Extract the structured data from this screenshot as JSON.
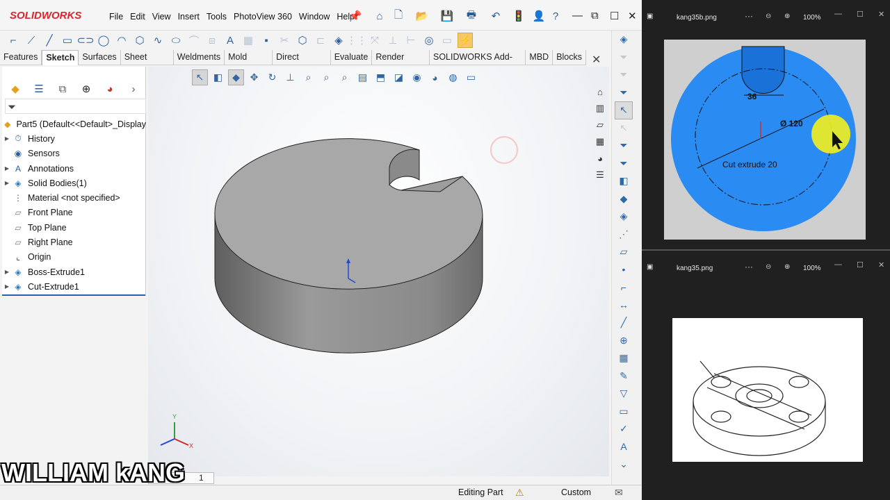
{
  "app": {
    "logo": "SOLIDWORKS",
    "menu": [
      "File",
      "Edit",
      "View",
      "Insert",
      "Tools",
      "PhotoView 360",
      "Window",
      "Help"
    ]
  },
  "tabs": [
    "Features",
    "Sketch",
    "Surfaces",
    "Sheet Metal",
    "Weldments",
    "Mold Tools",
    "Direct Editing",
    "Evaluate",
    "Render Tools",
    "SOLIDWORKS Add-Ins",
    "MBD",
    "Blocks"
  ],
  "active_tab": "Sketch",
  "feature_tree": {
    "root": "Part5  (Default<<Default>_Display",
    "items": [
      {
        "label": "History",
        "expandable": true,
        "icon": "history-icon"
      },
      {
        "label": "Sensors",
        "expandable": false,
        "icon": "sensors-icon"
      },
      {
        "label": "Annotations",
        "expandable": true,
        "icon": "annotations-icon"
      },
      {
        "label": "Solid Bodies(1)",
        "expandable": true,
        "icon": "solid-bodies-icon"
      },
      {
        "label": "Material <not specified>",
        "expandable": false,
        "icon": "material-icon"
      },
      {
        "label": "Front Plane",
        "expandable": false,
        "icon": "plane-icon"
      },
      {
        "label": "Top Plane",
        "expandable": false,
        "icon": "plane-icon"
      },
      {
        "label": "Right Plane",
        "expandable": false,
        "icon": "plane-icon"
      },
      {
        "label": "Origin",
        "expandable": false,
        "icon": "origin-icon"
      },
      {
        "label": "Boss-Extrude1",
        "expandable": true,
        "icon": "extrude-icon"
      },
      {
        "label": "Cut-Extrude1",
        "expandable": true,
        "icon": "cut-extrude-icon"
      }
    ]
  },
  "status": {
    "mode": "Editing Part",
    "units": "Custom",
    "sheet_tab": "1"
  },
  "watermark": "WILLIAM kANG",
  "viewer1": {
    "title": "kang35b.png",
    "zoom": "100%",
    "dims": {
      "slot": "36",
      "diameter": "Ø 120",
      "note": "Cut extrude 20"
    }
  },
  "viewer2": {
    "title": "kang35.png",
    "zoom": "100%"
  },
  "colors": {
    "accent": "#2b5fb4",
    "logo_red": "#d7262d",
    "model_grey": "#a3a3a3",
    "sketch_blue": "#1a8cf0"
  }
}
